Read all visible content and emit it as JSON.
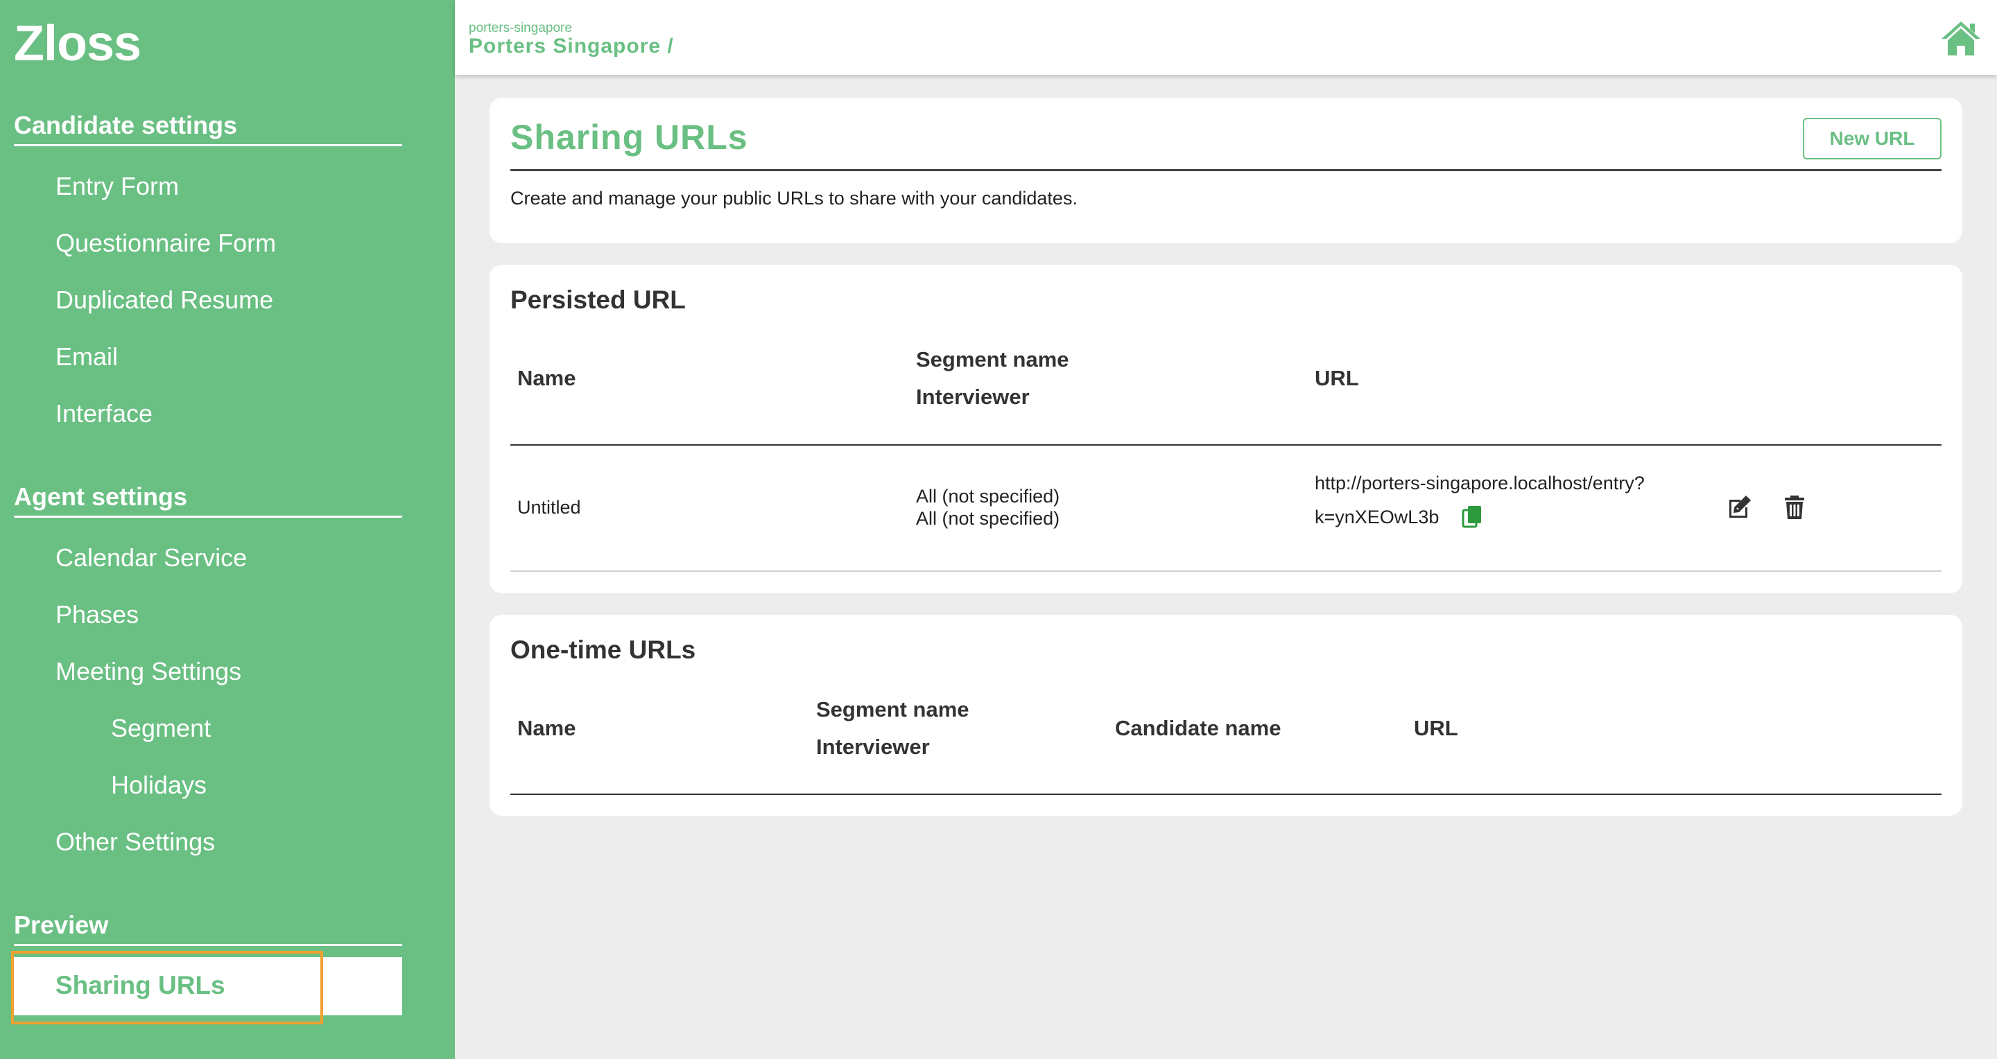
{
  "sidebar": {
    "logo": "Zloss",
    "candidate_settings": {
      "title": "Candidate settings",
      "items": [
        {
          "label": "Entry Form"
        },
        {
          "label": "Questionnaire Form"
        },
        {
          "label": "Duplicated Resume"
        },
        {
          "label": "Email"
        },
        {
          "label": "Interface"
        }
      ]
    },
    "agent_settings": {
      "title": "Agent settings",
      "items": [
        {
          "label": "Calendar Service"
        },
        {
          "label": "Phases"
        },
        {
          "label": "Meeting Settings"
        },
        {
          "label": "Segment"
        },
        {
          "label": "Holidays"
        },
        {
          "label": "Other Settings"
        }
      ]
    },
    "preview": {
      "title": "Preview",
      "active_item": "Sharing URLs"
    }
  },
  "header": {
    "org_slug": "porters-singapore",
    "breadcrumb": "Porters Singapore /",
    "home_icon": "home-icon"
  },
  "page": {
    "title": "Sharing URLs",
    "description": "Create and manage your public URLs to share with your candidates.",
    "new_url_label": "New URL"
  },
  "persisted": {
    "title": "Persisted URL",
    "columns": {
      "name": "Name",
      "segment": "Segment name",
      "interviewer": "Interviewer",
      "url": "URL"
    },
    "rows": [
      {
        "name": "Untitled",
        "segment": "All (not specified)",
        "interviewer": "All (not specified)",
        "url_line1": "http://porters-singapore.localhost/entry?",
        "url_line2": "k=ynXEOwL3b"
      }
    ]
  },
  "one_time": {
    "title": "One-time URLs",
    "columns": {
      "name": "Name",
      "segment": "Segment name",
      "interviewer": "Interviewer",
      "candidate": "Candidate name",
      "url": "URL"
    },
    "rows": []
  },
  "colors": {
    "brand_green": "#6abf83",
    "copy_icon_green": "#2e9a3e",
    "highlight_orange": "#f0a030"
  }
}
